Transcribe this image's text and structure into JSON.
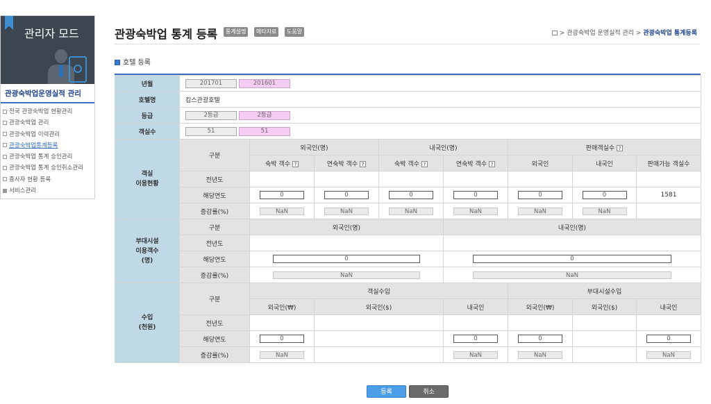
{
  "sidebar": {
    "banner_title": "관리자 모드",
    "section_title": "관광숙박업운영실적 관리",
    "items": [
      {
        "label": "전국 관광숙박업 현황관리"
      },
      {
        "label": "관광숙박업 관리"
      },
      {
        "label": "관광숙박업 이력관리"
      },
      {
        "label": "관광숙박업통계등록"
      },
      {
        "label": "관광숙박업 통계 승인관리"
      },
      {
        "label": "관광숙박업 통계 승인취소관리"
      },
      {
        "label": "종사자 현황 등록"
      },
      {
        "label": "서비스관리"
      }
    ]
  },
  "header": {
    "title": "관광숙박업 통계 등록",
    "buttons": [
      "통계설명",
      "메타자료",
      "도움말"
    ],
    "breadcrumb": {
      "path": "> 관광숙박업 운영실적 관리 >",
      "current": "관광숙박업 통계등록"
    }
  },
  "sub_title": "호텔 등록",
  "form": {
    "year_month": {
      "label": "년월",
      "current": "201701",
      "previous": "201601"
    },
    "hotel_name": {
      "label": "호텔명",
      "value": "킴스관광호텔"
    },
    "grade": {
      "label": "등급",
      "current": "2등급",
      "previous": "2등급"
    },
    "rooms": {
      "label": "객실수",
      "current": "51",
      "previous": "51"
    },
    "room_usage": {
      "label_1": "객실",
      "label_2": "이용현황",
      "category": "구분",
      "groups": {
        "foreign": "외국인(명)",
        "domestic": "내국인(명)",
        "sold_rooms": "판매객실수"
      },
      "cols": {
        "stay_rooms": "숙박 객수",
        "cont_rooms": "연숙박 객수",
        "foreigner": "외국인",
        "domestic": "내국인",
        "available": "판매가능 객실수"
      },
      "rows": {
        "prev_year": "전년도",
        "this_year": "해당연도",
        "rate": "증감률(%)"
      },
      "input_value": "0",
      "rate_value": "NaN",
      "available_value": "1581"
    },
    "facility_users": {
      "label_1": "부대시설",
      "label_2": "이용객수",
      "label_3": "(명)",
      "category": "구분",
      "foreign": "외국인(명)",
      "domestic": "내국인(명)",
      "rows": {
        "prev_year": "전년도",
        "this_year": "해당연도",
        "rate": "증감률(%)"
      },
      "input_value": "0",
      "rate_value": "NaN"
    },
    "income": {
      "label_1": "수입",
      "label_2": "(천원)",
      "category": "구분",
      "groups": {
        "room_income": "객실수입",
        "facility_income": "부대시설수입"
      },
      "cols": {
        "foreign_krw": "외국인(₩)",
        "foreign_usd": "외국인($)",
        "domestic": "내국인"
      },
      "rows": {
        "prev_year": "전년도",
        "this_year": "해당연도",
        "rate": "증감률(%)"
      },
      "input_value": "0",
      "rate_value": "NaN"
    }
  },
  "actions": {
    "register": "등록",
    "cancel": "취소"
  },
  "q_mark": "?"
}
